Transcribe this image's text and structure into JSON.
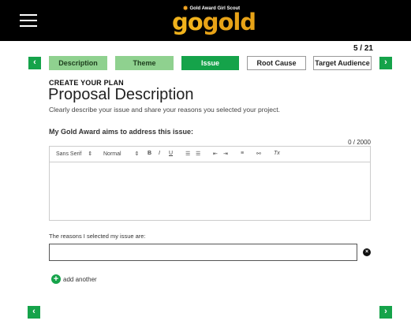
{
  "header": {
    "menu_icon": "hamburger-menu-icon",
    "logo": {
      "tagline": "Gold Award Girl Scout",
      "go": "go",
      "gold": "gold"
    }
  },
  "progress": {
    "counter": "5 / 21"
  },
  "steps": [
    {
      "label": "Description",
      "state": "done"
    },
    {
      "label": "Theme",
      "state": "done"
    },
    {
      "label": "Issue",
      "state": "active"
    },
    {
      "label": "Root Cause",
      "state": "todo"
    },
    {
      "label": "Target Audience",
      "state": "todo"
    }
  ],
  "nav": {
    "prev": "‹",
    "next": "›"
  },
  "page": {
    "section": "CREATE YOUR PLAN",
    "title": "Proposal Description",
    "subtitle": "Clearly describe your issue and share your reasons you selected your project."
  },
  "issue_question": {
    "label": "My Gold Award aims to address this issue:",
    "char_count": "0 / 2000"
  },
  "editor_toolbar": {
    "font": "Sans Serif",
    "size": "Normal",
    "select_arrow": "⇕",
    "bold": "B",
    "italic": "I",
    "underline": "U",
    "ordered_list": "☰",
    "bullet_list": "☰",
    "indent_in": "⇤",
    "indent_out": "⇥",
    "align": "≡",
    "link": "⚯",
    "clear_format": "Tx"
  },
  "reasons": {
    "label": "The reasons I selected my issue are:",
    "value": "",
    "clear": "×"
  },
  "add_another": {
    "icon": "+",
    "label": "add another"
  },
  "colors": {
    "green": "#15a34a",
    "light_green": "#8fd18f",
    "gold": "#f0b21c",
    "bar": "#000000"
  }
}
